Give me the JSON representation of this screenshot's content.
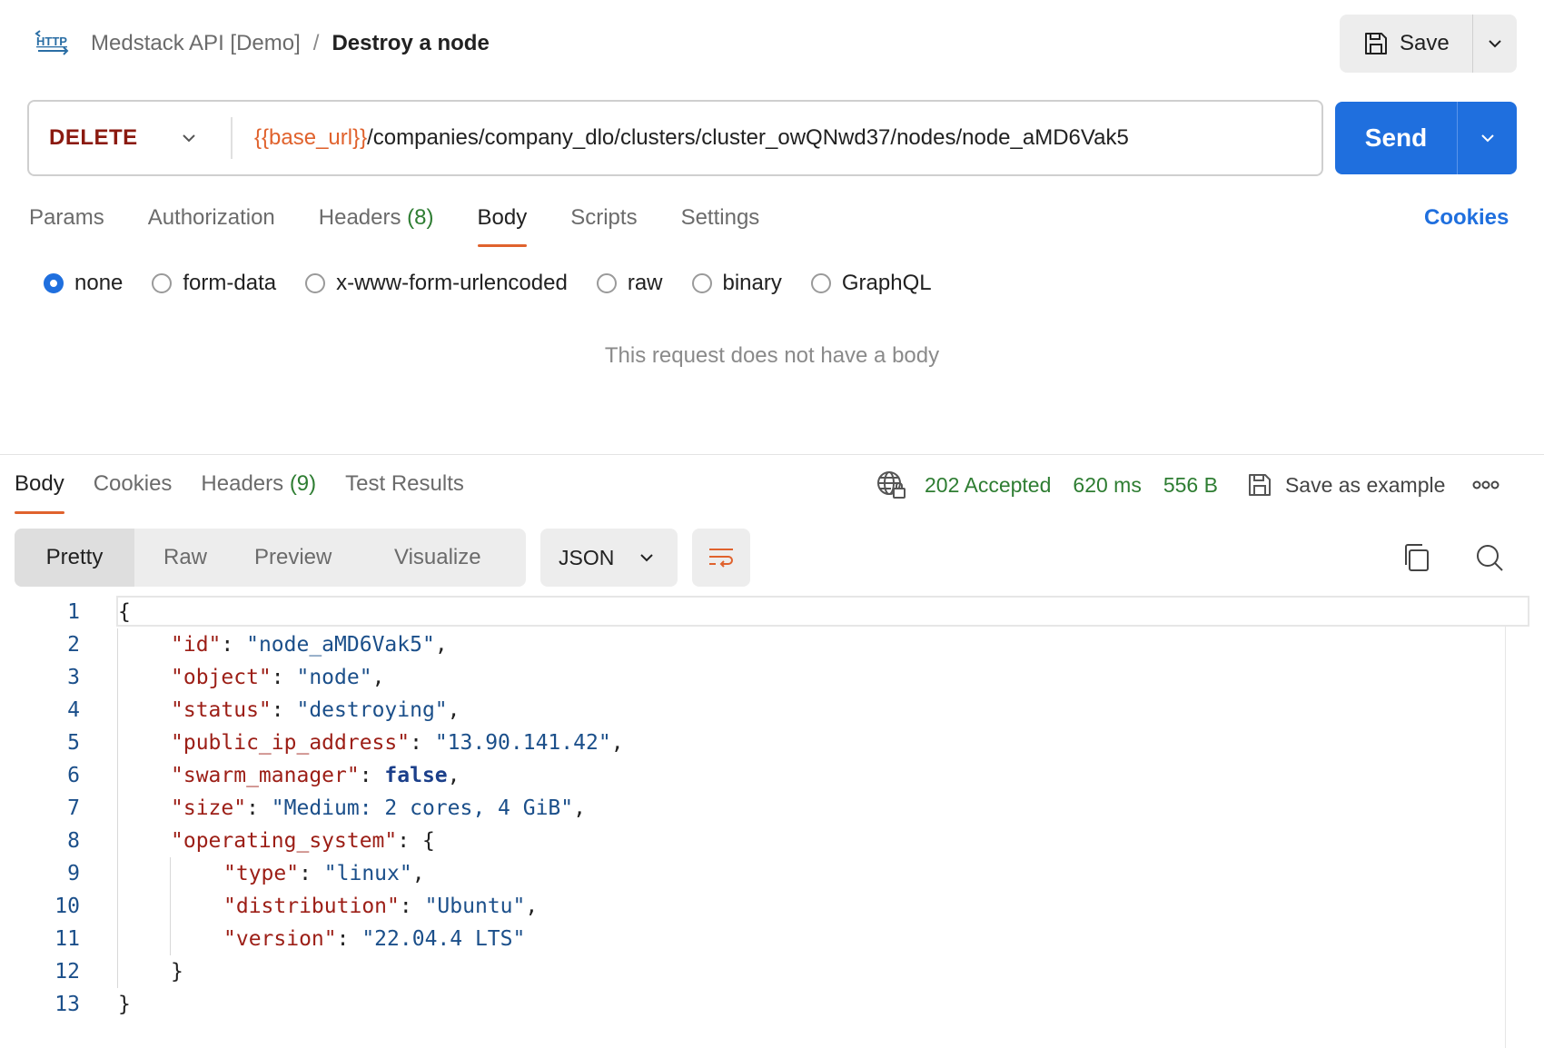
{
  "header": {
    "icon": "http-icon",
    "collection": "Medstack API [Demo]",
    "separator": "/",
    "request_name": "Destroy a node",
    "save_label": "Save"
  },
  "request": {
    "method": "DELETE",
    "url_variable": "{{base_url}}",
    "url_path": "/companies/company_dlo/clusters/cluster_owQNwd37/nodes/node_aMD6Vak5",
    "send_label": "Send"
  },
  "request_tabs": [
    {
      "label": "Params"
    },
    {
      "label": "Authorization"
    },
    {
      "label": "Headers",
      "count": "(8)"
    },
    {
      "label": "Body",
      "active": true
    },
    {
      "label": "Scripts"
    },
    {
      "label": "Settings"
    }
  ],
  "cookies_link": "Cookies",
  "body_types": [
    {
      "label": "none",
      "checked": true
    },
    {
      "label": "form-data"
    },
    {
      "label": "x-www-form-urlencoded"
    },
    {
      "label": "raw"
    },
    {
      "label": "binary"
    },
    {
      "label": "GraphQL"
    }
  ],
  "empty_body_message": "This request does not have a body",
  "response_tabs": [
    {
      "label": "Body",
      "active": true
    },
    {
      "label": "Cookies"
    },
    {
      "label": "Headers",
      "count": "(9)"
    },
    {
      "label": "Test Results"
    }
  ],
  "response_meta": {
    "status": "202 Accepted",
    "time": "620 ms",
    "size": "556 B",
    "save_example_label": "Save as example"
  },
  "view_modes": [
    "Pretty",
    "Raw",
    "Preview",
    "Visualize"
  ],
  "active_view": "Pretty",
  "format": "JSON",
  "colors": {
    "accent_orange": "#e0622d",
    "send_blue": "#1f6fde",
    "method_red": "#8b1a10",
    "success_green": "#2e7d32"
  },
  "code_lines": [
    {
      "n": "1",
      "indent": 0,
      "tokens": [
        [
          "p",
          "{"
        ]
      ]
    },
    {
      "n": "2",
      "indent": 1,
      "tokens": [
        [
          "k",
          "\"id\""
        ],
        [
          "p",
          ": "
        ],
        [
          "s",
          "\"node_aMD6Vak5\""
        ],
        [
          "p",
          ","
        ]
      ]
    },
    {
      "n": "3",
      "indent": 1,
      "tokens": [
        [
          "k",
          "\"object\""
        ],
        [
          "p",
          ": "
        ],
        [
          "s",
          "\"node\""
        ],
        [
          "p",
          ","
        ]
      ]
    },
    {
      "n": "4",
      "indent": 1,
      "tokens": [
        [
          "k",
          "\"status\""
        ],
        [
          "p",
          ": "
        ],
        [
          "s",
          "\"destroying\""
        ],
        [
          "p",
          ","
        ]
      ]
    },
    {
      "n": "5",
      "indent": 1,
      "tokens": [
        [
          "k",
          "\"public_ip_address\""
        ],
        [
          "p",
          ": "
        ],
        [
          "s",
          "\"13.90.141.42\""
        ],
        [
          "p",
          ","
        ]
      ]
    },
    {
      "n": "6",
      "indent": 1,
      "tokens": [
        [
          "k",
          "\"swarm_manager\""
        ],
        [
          "p",
          ": "
        ],
        [
          "b",
          "false"
        ],
        [
          "p",
          ","
        ]
      ]
    },
    {
      "n": "7",
      "indent": 1,
      "tokens": [
        [
          "k",
          "\"size\""
        ],
        [
          "p",
          ": "
        ],
        [
          "s",
          "\"Medium: 2 cores, 4 GiB\""
        ],
        [
          "p",
          ","
        ]
      ]
    },
    {
      "n": "8",
      "indent": 1,
      "tokens": [
        [
          "k",
          "\"operating_system\""
        ],
        [
          "p",
          ": {"
        ]
      ]
    },
    {
      "n": "9",
      "indent": 2,
      "tokens": [
        [
          "k",
          "\"type\""
        ],
        [
          "p",
          ": "
        ],
        [
          "s",
          "\"linux\""
        ],
        [
          "p",
          ","
        ]
      ]
    },
    {
      "n": "10",
      "indent": 2,
      "tokens": [
        [
          "k",
          "\"distribution\""
        ],
        [
          "p",
          ": "
        ],
        [
          "s",
          "\"Ubuntu\""
        ],
        [
          "p",
          ","
        ]
      ]
    },
    {
      "n": "11",
      "indent": 2,
      "tokens": [
        [
          "k",
          "\"version\""
        ],
        [
          "p",
          ": "
        ],
        [
          "s",
          "\"22.04.4 LTS\""
        ]
      ]
    },
    {
      "n": "12",
      "indent": 1,
      "tokens": [
        [
          "p",
          "}"
        ]
      ]
    },
    {
      "n": "13",
      "indent": 0,
      "tokens": [
        [
          "p",
          "}"
        ]
      ]
    }
  ]
}
